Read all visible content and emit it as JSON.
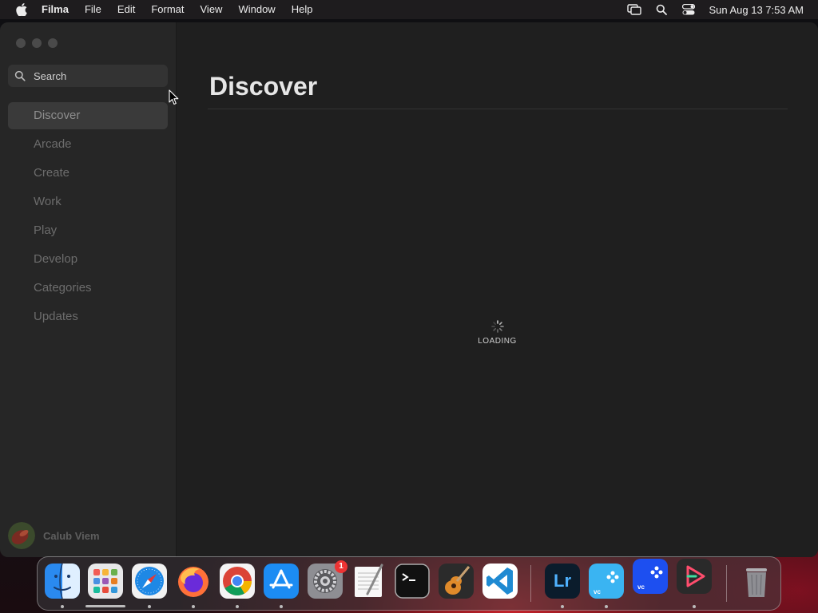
{
  "menubar": {
    "app_name": "Filma",
    "items": [
      "File",
      "Edit",
      "Format",
      "View",
      "Window",
      "Help"
    ],
    "clock": "Sun Aug 13  7:53 AM"
  },
  "sidebar": {
    "search_placeholder": "Search",
    "items": [
      {
        "label": "Discover",
        "active": true
      },
      {
        "label": "Arcade"
      },
      {
        "label": "Create"
      },
      {
        "label": "Work"
      },
      {
        "label": "Play"
      },
      {
        "label": "Develop"
      },
      {
        "label": "Categories"
      },
      {
        "label": "Updates"
      }
    ],
    "user_name": "Calub Viem"
  },
  "main": {
    "title": "Discover",
    "loading_label": "LOADING"
  },
  "dock": {
    "system_preferences_badge": "1",
    "lightroom_label": "Lr",
    "vc_label_1": "vc",
    "vc_label_2": "vc"
  },
  "colors": {
    "window_bg": "#202020",
    "sidebar_bg": "#262626",
    "accent_red": "#c8242c"
  }
}
